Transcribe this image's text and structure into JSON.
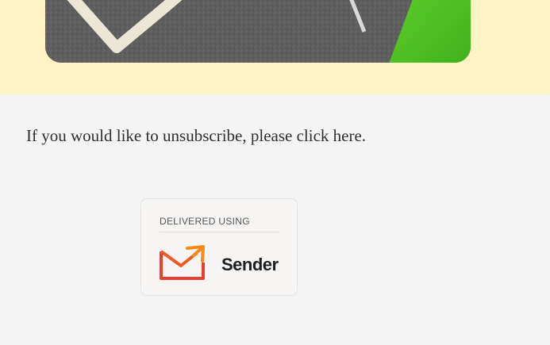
{
  "footer": {
    "unsubscribe_prefix": "If you would like to unsubscribe, please click ",
    "unsubscribe_link": "here",
    "unsubscribe_suffix": "."
  },
  "badge": {
    "caption": "DELIVERED USING",
    "brand": "Sender"
  },
  "colors": {
    "hero_band": "#fff2c4",
    "page_background": "#f4f4f4",
    "brand_red": "#e8402f",
    "brand_orange": "#f28a1c"
  }
}
